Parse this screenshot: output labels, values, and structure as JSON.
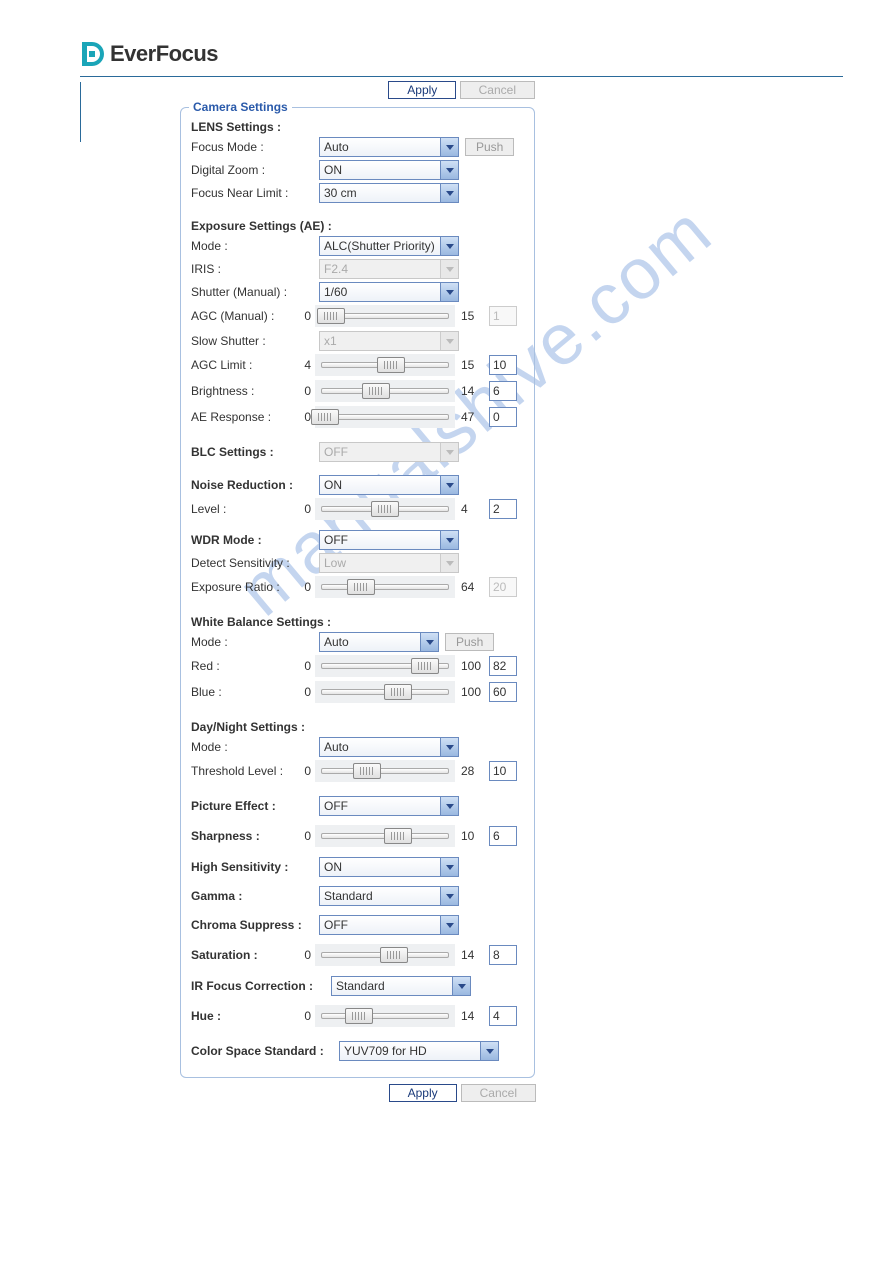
{
  "brand": "EverFocus",
  "watermark": "manualshive.com",
  "buttons": {
    "apply": "Apply",
    "cancel": "Cancel",
    "push": "Push"
  },
  "panel_title": "Camera Settings",
  "lens": {
    "heading": "LENS Settings :",
    "focus_mode_label": "Focus Mode :",
    "focus_mode": "Auto",
    "digital_zoom_label": "Digital Zoom :",
    "digital_zoom": "ON",
    "focus_near_label": "Focus Near Limit :",
    "focus_near": "30 cm"
  },
  "exposure": {
    "heading": "Exposure Settings (AE) :",
    "mode_label": "Mode :",
    "mode": "ALC(Shutter Priority)",
    "iris_label": "IRIS :",
    "iris": "F2.4",
    "shutter_label": "Shutter (Manual) :",
    "shutter": "1/60",
    "agc_manual_label": "AGC (Manual) :",
    "agc_manual_min": "0",
    "agc_manual_max": "15",
    "agc_manual_val": "1",
    "slow_shutter_label": "Slow Shutter :",
    "slow_shutter": "x1",
    "agc_limit_label": "AGC Limit :",
    "agc_limit_min": "4",
    "agc_limit_max": "15",
    "agc_limit_val": "10",
    "brightness_label": "Brightness :",
    "brightness_min": "0",
    "brightness_max": "14",
    "brightness_val": "6",
    "ae_resp_label": "AE Response :",
    "ae_resp_min": "0",
    "ae_resp_max": "47",
    "ae_resp_val": "0"
  },
  "blc": {
    "label": "BLC Settings :",
    "value": "OFF"
  },
  "nr": {
    "label": "Noise Reduction :",
    "value": "ON",
    "level_label": "Level :",
    "level_min": "0",
    "level_max": "4",
    "level_val": "2"
  },
  "wdr": {
    "label": "WDR Mode :",
    "value": "OFF",
    "detect_label": "Detect Sensitivity :",
    "detect": "Low",
    "ratio_label": "Exposure Ratio :",
    "ratio_min": "0",
    "ratio_max": "64",
    "ratio_val": "20"
  },
  "wb": {
    "heading": "White Balance Settings :",
    "mode_label": "Mode :",
    "mode": "Auto",
    "red_label": "Red :",
    "red_min": "0",
    "red_max": "100",
    "red_val": "82",
    "blue_label": "Blue :",
    "blue_min": "0",
    "blue_max": "100",
    "blue_val": "60"
  },
  "dn": {
    "heading": "Day/Night Settings :",
    "mode_label": "Mode :",
    "mode": "Auto",
    "thresh_label": "Threshold Level :",
    "thresh_min": "0",
    "thresh_max": "28",
    "thresh_val": "10"
  },
  "picture_effect": {
    "label": "Picture Effect :",
    "value": "OFF"
  },
  "sharpness": {
    "label": "Sharpness :",
    "min": "0",
    "max": "10",
    "val": "6"
  },
  "high_sens": {
    "label": "High Sensitivity :",
    "value": "ON"
  },
  "gamma": {
    "label": "Gamma :",
    "value": "Standard"
  },
  "chroma": {
    "label": "Chroma Suppress :",
    "value": "OFF"
  },
  "saturation": {
    "label": "Saturation :",
    "min": "0",
    "max": "14",
    "val": "8"
  },
  "ir_focus": {
    "label": "IR Focus Correction :",
    "value": "Standard"
  },
  "hue": {
    "label": "Hue :",
    "min": "0",
    "max": "14",
    "val": "4"
  },
  "color_space": {
    "label": "Color Space Standard :",
    "value": "YUV709 for HD"
  }
}
